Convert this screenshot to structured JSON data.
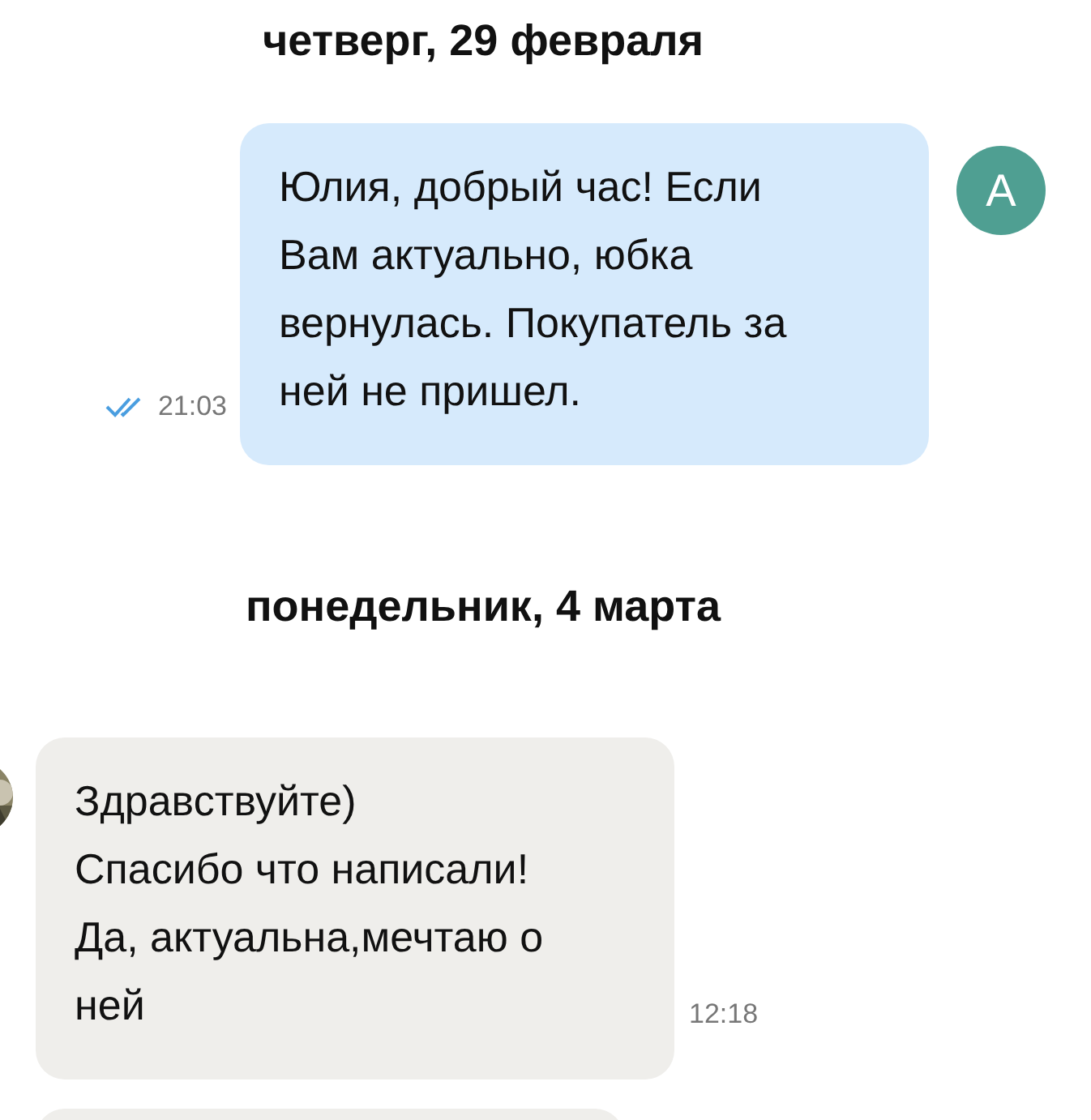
{
  "messages": [
    {
      "kind": "date",
      "text": "четверг, 29 февраля"
    },
    {
      "kind": "outgoing",
      "text": "Юлия, добрый час! Если\nВам актуально, юбка\nвернулась. Покупатель за\nней не пришел.",
      "time": "21:03",
      "read": true,
      "avatar": "А"
    },
    {
      "kind": "date",
      "text": "понедельник, 4 марта"
    },
    {
      "kind": "incoming",
      "text": "Здравствуйте)\nСпасибо что написали!\nДа, актуальна,мечтаю о\nней",
      "time": "12:18"
    },
    {
      "kind": "incoming_cut"
    }
  ]
}
